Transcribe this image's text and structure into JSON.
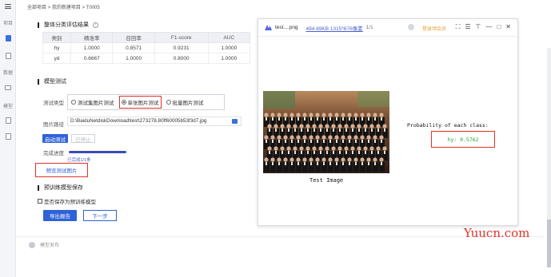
{
  "breadcrumb": "全部项目 > 我的新建项目 > T0005",
  "sidebar": {
    "items": [
      {
        "label": "",
        "icon": "menu-icon"
      },
      {
        "label": "项目",
        "icon": "project-label"
      },
      {
        "label": "",
        "icon": "folder-icon",
        "active": true
      },
      {
        "label": "",
        "icon": "file-icon"
      },
      {
        "label": "数据",
        "icon": "data-label"
      },
      {
        "label": "",
        "icon": "monitor-icon"
      },
      {
        "label": "模型",
        "icon": "model-label"
      },
      {
        "label": "",
        "icon": "doc-icon"
      },
      {
        "label": "",
        "icon": "doc2-icon"
      }
    ]
  },
  "eval": {
    "title": "整体分类评估结果",
    "columns": [
      "类别",
      "精准率",
      "召回率",
      "F1-score",
      "AUC"
    ],
    "rows": [
      [
        "hy",
        "1.0000",
        "0.8571",
        "0.9231",
        "1.0000"
      ],
      [
        "yd",
        "0.6667",
        "1.0000",
        "0.8000",
        "1.0000"
      ]
    ]
  },
  "test": {
    "title": "模型测试",
    "type_label": "测试类型",
    "options": [
      "测试集图片测试",
      "单张图片测试",
      "批量图片测试"
    ],
    "selected_index": 1,
    "path_label": "图片路径",
    "path_value": "D:\\BaiduNetdiskDownload\\test\\273278,80ff60005b53f3d7.jpg",
    "start_button": "启动测试",
    "stop_button": "已停止",
    "progress_label": "完成进度",
    "progress_fraction": 1.0,
    "progress_text": "已完成1/1条",
    "preview_link": "预览测试图片"
  },
  "save": {
    "title": "预训练模型保存",
    "checkbox_label": "是否保存为预训练模型",
    "export_button": "导出报告",
    "next_button": "下一步"
  },
  "footer": {
    "text": "模型发布"
  },
  "viewer": {
    "filename": "test....png",
    "meta": "494.69KB  1315*676像素",
    "pages": "1/1",
    "vip_badge": "登录领会员",
    "controls": [
      "⛶",
      "☰",
      "⊤",
      "—",
      "□",
      "✕"
    ],
    "caption": "Test Image",
    "prob_title": "Probability of each class:",
    "prob_result": "hy: 0.5762"
  },
  "watermark": "Yuucn.com"
}
